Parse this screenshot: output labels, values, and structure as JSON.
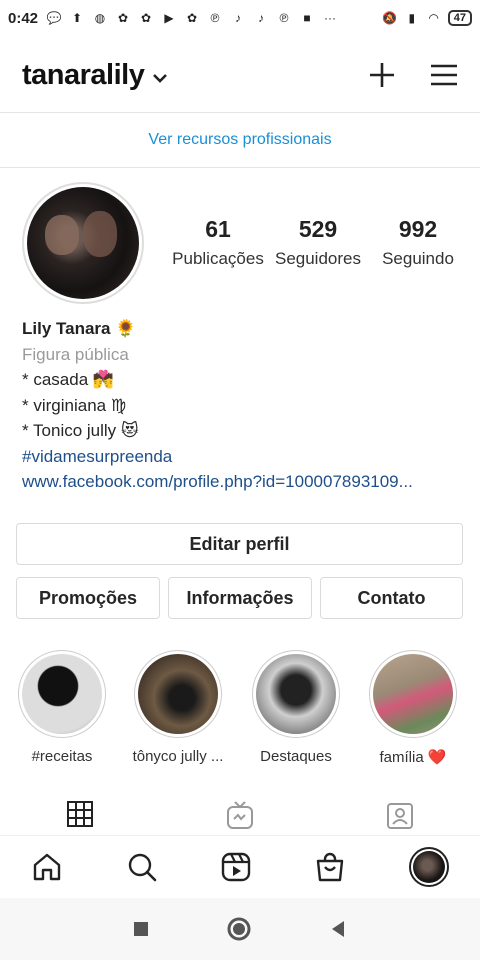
{
  "status_bar": {
    "time": "0:42",
    "battery": "47"
  },
  "header": {
    "username": "tanaralily"
  },
  "pro_link": "Ver recursos profissionais",
  "stats": [
    {
      "value": "61",
      "label": "Publicações"
    },
    {
      "value": "529",
      "label": "Seguidores"
    },
    {
      "value": "992",
      "label": "Seguindo"
    }
  ],
  "bio": {
    "name": "Lily Tanara 🌻",
    "category": "Figura pública",
    "lines": [
      "* casada 💏",
      "* virginiana ♍",
      "* Tonico jully 😻"
    ],
    "hashtag": "#vidamesurpreenda",
    "link": "www.facebook.com/profile.php?id=100007893109..."
  },
  "buttons": {
    "edit_profile": "Editar perfil",
    "promotions": "Promoções",
    "info": "Informações",
    "contact": "Contato"
  },
  "highlights": [
    {
      "caption": "#receitas"
    },
    {
      "caption": "tônyco jully ..."
    },
    {
      "caption": "Destaques"
    },
    {
      "caption": "família ❤️"
    }
  ],
  "icons": {
    "header": [
      "chevron-down-icon",
      "plus-icon",
      "menu-icon"
    ],
    "tabs": [
      "grid-icon",
      "igtv-icon",
      "tagged-icon"
    ],
    "bottom_nav": [
      "home-icon",
      "search-icon",
      "reels-icon",
      "shop-icon",
      "profile-avatar"
    ]
  }
}
